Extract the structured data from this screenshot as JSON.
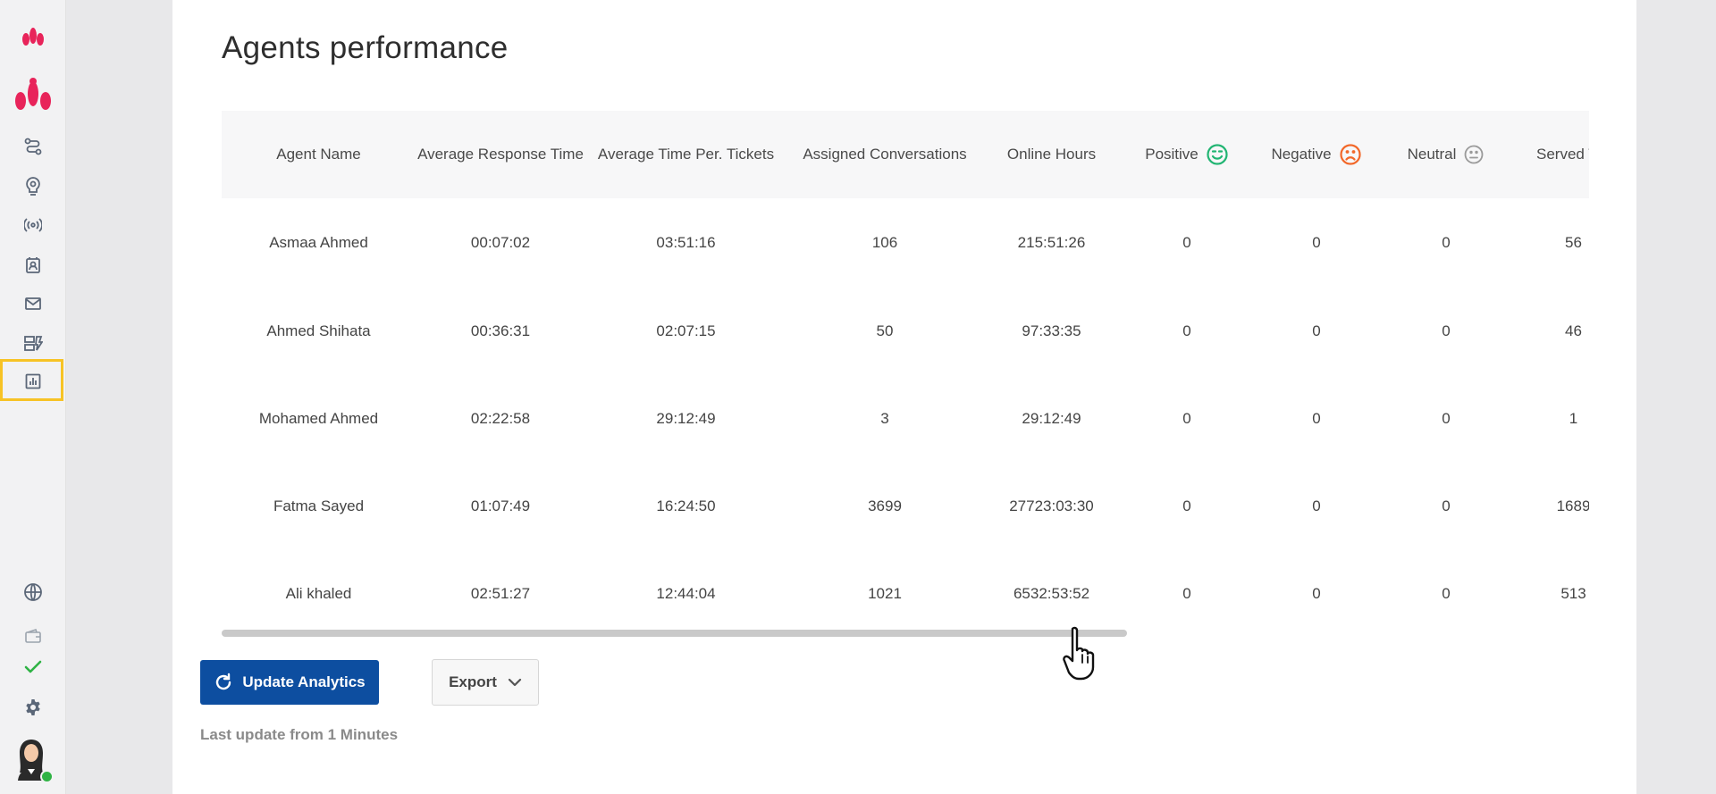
{
  "sidebar": {
    "items": [
      {
        "icon": "brand-logo-small-icon"
      },
      {
        "icon": "brand-logo-icon"
      },
      {
        "icon": "route-icon"
      },
      {
        "icon": "brain-bulb-icon"
      },
      {
        "icon": "broadcast-icon"
      },
      {
        "icon": "contacts-icon"
      },
      {
        "icon": "mail-icon"
      },
      {
        "icon": "tickets-icon"
      },
      {
        "icon": "analytics-icon",
        "active": true
      },
      {
        "icon": "globe-icon"
      },
      {
        "icon": "wallet-icon"
      },
      {
        "icon": "check-icon"
      },
      {
        "icon": "settings-icon"
      }
    ],
    "accent_color": "#f7c325",
    "brand_color": "#e8245a"
  },
  "page": {
    "title": "Agents performance"
  },
  "table": {
    "columns": [
      {
        "label": "Agent Name"
      },
      {
        "label": "Average Response Time"
      },
      {
        "label": "Average Time Per. Tickets"
      },
      {
        "label": "Assigned Conversations"
      },
      {
        "label": "Online Hours"
      },
      {
        "label": "Positive",
        "icon": "smile-icon",
        "icon_color": "#22b573"
      },
      {
        "label": "Negative",
        "icon": "sad-icon",
        "icon_color": "#f2682a"
      },
      {
        "label": "Neutral",
        "icon": "neutral-face-icon",
        "icon_color": "#9a9a9a"
      },
      {
        "label": "Served Ti"
      }
    ],
    "rows": [
      [
        "Asmaa Ahmed",
        "00:07:02",
        "03:51:16",
        "106",
        "215:51:26",
        "0",
        "0",
        "0",
        "56"
      ],
      [
        "Ahmed Shihata",
        "00:36:31",
        "02:07:15",
        "50",
        "97:33:35",
        "0",
        "0",
        "0",
        "46"
      ],
      [
        "Mohamed Ahmed",
        "02:22:58",
        "29:12:49",
        "3",
        "29:12:49",
        "0",
        "0",
        "0",
        "1"
      ],
      [
        "Fatma Sayed",
        "01:07:49",
        "16:24:50",
        "3699",
        "27723:03:30",
        "0",
        "0",
        "0",
        "1689"
      ],
      [
        "Ali khaled",
        "02:51:27",
        "12:44:04",
        "1021",
        "6532:53:52",
        "0",
        "0",
        "0",
        "513"
      ]
    ]
  },
  "actions": {
    "update_label": "Update Analytics",
    "update_color": "#0d4ea0",
    "export_label": "Export",
    "last_update": "Last update from 1 Minutes"
  }
}
